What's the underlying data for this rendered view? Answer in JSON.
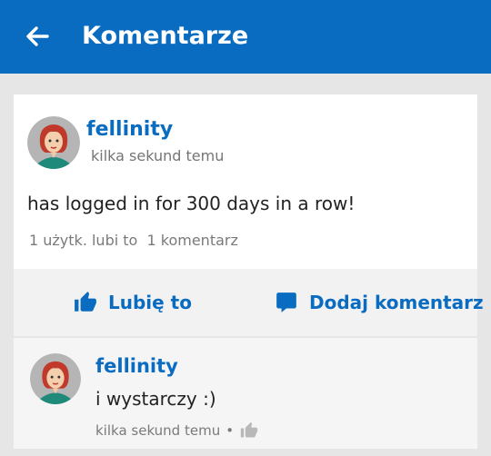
{
  "colors": {
    "topbar": "#0a6cc1",
    "accent": "#0a6cc1",
    "background": "#e6e6e6",
    "card": "#ffffff",
    "muted_text": "#757575"
  },
  "topbar": {
    "back_icon": "arrow-left-icon",
    "title": "Komentarze"
  },
  "post": {
    "author": "fellinity",
    "time": "kilka sekund temu",
    "text": "has logged in for 300 days in a row!",
    "likes": "1 użytk. lubi to",
    "comments": "1 komentarz"
  },
  "actions": {
    "like_icon": "thumbs-up-icon",
    "like_label": "Lubię to",
    "comment_icon": "speech-bubble-icon",
    "comment_label": "Dodaj komentarz"
  },
  "comment": {
    "author": "fellinity",
    "text": "i wystarczy :)",
    "time": "kilka sekund temu",
    "separator": "•",
    "like_icon": "thumbs-up-icon"
  }
}
